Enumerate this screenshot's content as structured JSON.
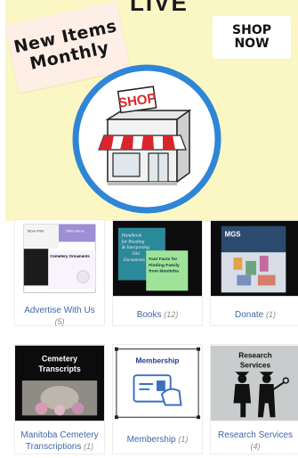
{
  "hero": {
    "top_partial_text": "LIVE",
    "new_items_line1": "New Items",
    "new_items_line2": "Monthly",
    "shop_now_line1": "SHOP",
    "shop_now_line2": "NOW",
    "store_sign": "SHOP",
    "colors": {
      "banner_bg": "#fbf7c4",
      "ring": "#2f86d6",
      "awning_red": "#d8262d"
    }
  },
  "categories": [
    {
      "name": "Advertise With Us",
      "count": "(5)",
      "thumb_text": [
        "Store Print",
        "Office Items",
        "Cemetery Ornaments"
      ]
    },
    {
      "name": "Books",
      "count": "(12)",
      "thumb_text": [
        "Handbook",
        "for Reading",
        "& Interpreting",
        "Old",
        "Documents",
        "Fast Facts for",
        "Finding Family",
        "from Manitoba"
      ]
    },
    {
      "name": "Donate",
      "count": "(1)",
      "thumb_text": [
        "MGS"
      ]
    },
    {
      "name": "Manitoba Cemetery Transcriptions",
      "name_line1": "Manitoba Cemetery",
      "name_line2": "Transcriptions",
      "count": "(1)",
      "thumb_text": [
        "Cemetery",
        "Transcripts"
      ]
    },
    {
      "name": "Membership",
      "count": "(1)",
      "thumb_text": [
        "Membership"
      ]
    },
    {
      "name": "Research Services",
      "count": "(4)",
      "thumb_text": [
        "Research",
        "Services"
      ]
    }
  ]
}
